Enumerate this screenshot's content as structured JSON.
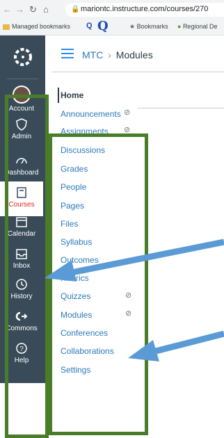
{
  "browser": {
    "url": "mariontc.instructure.com/courses/270",
    "bookmarks": [
      {
        "label": "Managed bookmarks",
        "icon": "folder-icon"
      },
      {
        "label": "Q",
        "icon": "q-icon"
      },
      {
        "label": "Q",
        "icon": "q-logo-icon"
      },
      {
        "label": "Bookmarks",
        "icon": "star-icon"
      },
      {
        "label": "Regional De",
        "icon": "globe-icon"
      }
    ]
  },
  "global_nav": {
    "items": [
      {
        "label": "Account",
        "icon": "avatar-icon"
      },
      {
        "label": "Admin",
        "icon": "shield-icon"
      },
      {
        "label": "Dashboard",
        "icon": "dashboard-icon"
      },
      {
        "label": "Courses",
        "icon": "book-icon",
        "active": true
      },
      {
        "label": "Calendar",
        "icon": "calendar-icon"
      },
      {
        "label": "Inbox",
        "icon": "inbox-icon"
      },
      {
        "label": "History",
        "icon": "clock-icon"
      },
      {
        "label": "Commons",
        "icon": "commons-icon"
      },
      {
        "label": "Help",
        "icon": "help-icon"
      }
    ]
  },
  "breadcrumb": {
    "course": "MTC",
    "separator": "›",
    "current": "Modules"
  },
  "course_nav": [
    "Home",
    "Announcements",
    "Assignments",
    "Discussions",
    "Grades",
    "People",
    "Pages",
    "Files",
    "Syllabus",
    "Outcomes",
    "Rubrics",
    "Quizzes",
    "Modules",
    "Conferences",
    "Collaborations",
    "Settings"
  ],
  "hidden_icon": "eye-slash-icon",
  "colors": {
    "nav_bg": "#394b58",
    "link": "#2b7abc",
    "frame": "#4a7d2a",
    "arrow": "#5b9bd5",
    "active": "#e0261d"
  }
}
